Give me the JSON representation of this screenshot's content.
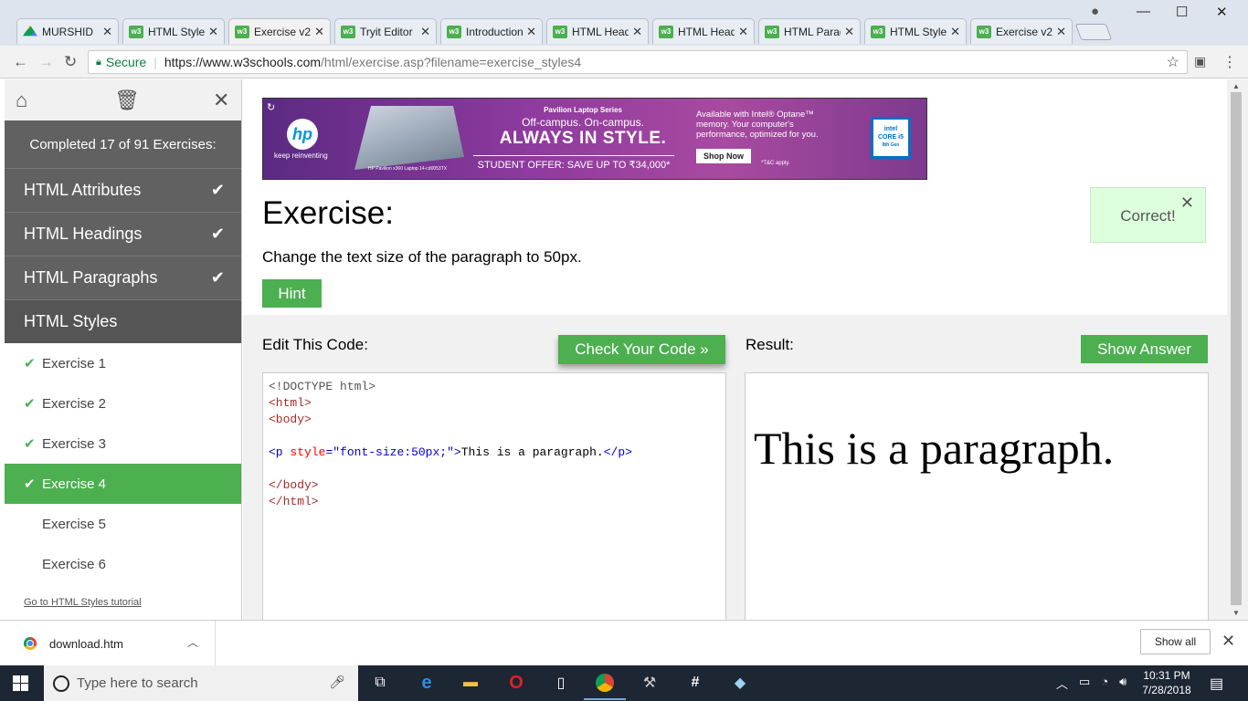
{
  "browser": {
    "tabs": [
      {
        "title": "MURSHID",
        "icon": "google-drive-icon"
      },
      {
        "title": "HTML Styles",
        "icon": "w3schools-icon"
      },
      {
        "title": "Exercise v2",
        "icon": "w3schools-icon",
        "active": true
      },
      {
        "title": "Tryit Editor",
        "icon": "w3schools-icon"
      },
      {
        "title": "Introduction",
        "icon": "w3schools-icon"
      },
      {
        "title": "HTML Headings",
        "icon": "w3schools-icon"
      },
      {
        "title": "HTML Headings",
        "icon": "w3schools-icon"
      },
      {
        "title": "HTML Paragraphs",
        "icon": "w3schools-icon"
      },
      {
        "title": "HTML Styles",
        "icon": "w3schools-icon"
      },
      {
        "title": "Exercise v2",
        "icon": "w3schools-icon"
      }
    ],
    "tab_favicon_text": "w3",
    "tab_close": "✕",
    "secure_label": "Secure",
    "url_host": "https://www.w3schools.com",
    "url_path": "/html/exercise.asp?filename=exercise_styles4"
  },
  "sidebar": {
    "completed": "Completed 17 of 91 Exercises:",
    "sections": [
      {
        "label": "HTML Attributes",
        "done": true
      },
      {
        "label": "HTML Headings",
        "done": true
      },
      {
        "label": "HTML Paragraphs",
        "done": true
      },
      {
        "label": "HTML Styles",
        "done": false
      }
    ],
    "exercises": [
      {
        "label": "Exercise 1",
        "done": true
      },
      {
        "label": "Exercise 2",
        "done": true
      },
      {
        "label": "Exercise 3",
        "done": true
      },
      {
        "label": "Exercise 4",
        "done": true,
        "active": true
      },
      {
        "label": "Exercise 5",
        "done": false
      },
      {
        "label": "Exercise 6",
        "done": false
      }
    ],
    "tutorial_link": "Go to HTML Styles tutorial"
  },
  "ad": {
    "brand_tag": "keep reinventing",
    "series": "Pavilion Laptop Series",
    "tagline": "Off-campus. On-campus.",
    "headline": "ALWAYS IN STYLE.",
    "offer": "STUDENT OFFER: SAVE UP TO ₹34,000*",
    "intel_text": "Available with Intel® Optane™ memory. Your computer's performance, optimized for you.",
    "shop_now": "Shop Now",
    "tc": "*T&C apply.",
    "intel_badge": "CORE i5",
    "laptop_caption": "HP Pavilion x360 Laptop 14-cd0053TX",
    "intel_small": "intel",
    "intel_gen": "8th Gen"
  },
  "exercise": {
    "title": "Exercise:",
    "description": "Change the text size of the paragraph to 50px.",
    "hint": "Hint",
    "correct": "Correct!",
    "edit_label": "Edit This Code:",
    "check_button": "Check Your Code »",
    "result_label": "Result:",
    "show_answer": "Show Answer",
    "code": {
      "doctype": "<!DOCTYPE html>",
      "html_open": "<html>",
      "body_open": "<body>",
      "p_open": "<p",
      "attr_name": "style",
      "attr_eq": "=",
      "attr_value": "\"font-size:50px;\"",
      "p_close_bracket": ">",
      "p_text": "This is a paragraph.",
      "p_close": "</p>",
      "body_close": "</body>",
      "html_close": "</html>"
    },
    "result_text": "This is a paragraph."
  },
  "downloads": {
    "file": "download.htm",
    "show_all": "Show all"
  },
  "taskbar": {
    "search_placeholder": "Type here to search",
    "time": "10:31 PM",
    "date": "7/28/2018"
  },
  "colors": {
    "accent_green": "#4caf50",
    "sidebar_dark": "#616161",
    "correct_bg": "#ddffdd"
  }
}
